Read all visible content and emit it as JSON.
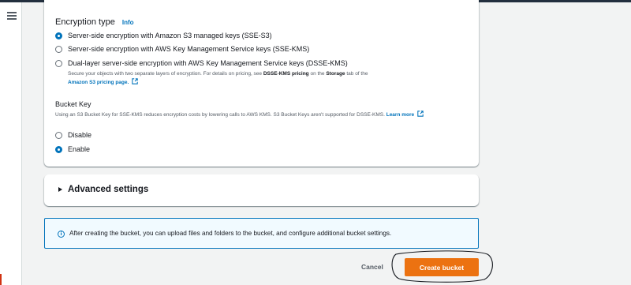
{
  "sidebar": {
    "menu_icon": "hamburger-menu-icon"
  },
  "encryption": {
    "label": "Encryption type",
    "info_link": "Info",
    "options": [
      {
        "label": "Server-side encryption with Amazon S3 managed keys (SSE-S3)",
        "checked": true
      },
      {
        "label": "Server-side encryption with AWS Key Management Service keys (SSE-KMS)",
        "checked": false
      },
      {
        "label": "Dual-layer server-side encryption with AWS Key Management Service keys (DSSE-KMS)",
        "checked": false
      }
    ],
    "dsse_desc": {
      "text1": "Secure your objects with two separate layers of encryption. For details on pricing, see ",
      "bold1": "DSSE-KMS pricing",
      "text2": " on the ",
      "bold2": "Storage",
      "text3": " tab of the",
      "link": "Amazon S3 pricing page."
    }
  },
  "bucket_key": {
    "title": "Bucket Key",
    "desc": "Using an S3 Bucket Key for SSE-KMS reduces encryption costs by lowering calls to AWS KMS. S3 Bucket Keys aren't supported for DSSE-KMS.",
    "learn_more": "Learn more",
    "options": [
      {
        "label": "Disable",
        "checked": false
      },
      {
        "label": "Enable",
        "checked": true
      }
    ]
  },
  "advanced": {
    "label": "Advanced settings"
  },
  "info_box": {
    "text": "After creating the bucket, you can upload files and folders to the bucket, and configure additional bucket settings."
  },
  "actions": {
    "cancel": "Cancel",
    "create": "Create bucket"
  },
  "colors": {
    "accent": "#0073bb",
    "primary_button": "#ec7211"
  }
}
